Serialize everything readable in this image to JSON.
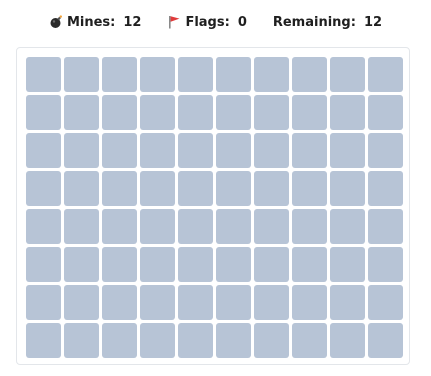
{
  "status": {
    "mines": {
      "icon": "bomb-icon",
      "label": "Mines",
      "value": "12"
    },
    "flags": {
      "icon": "red-flag-icon",
      "label": "Flags",
      "value": "0"
    },
    "remaining": {
      "label": "Remaining",
      "value": "12"
    }
  },
  "board": {
    "rows": 8,
    "cols": 10,
    "cell_state": "covered",
    "cell_color": "#b7c4d6"
  }
}
